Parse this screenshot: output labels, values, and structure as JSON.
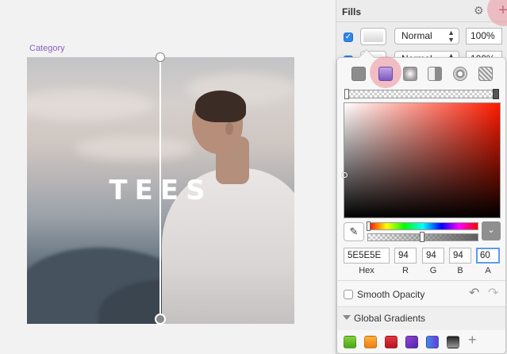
{
  "canvas": {
    "artboard_label": "Category",
    "artboard_text": "TEES"
  },
  "inspector": {
    "fills_title": "Fills",
    "icons": {
      "settings": "gear-icon",
      "add": "plus-icon"
    },
    "fills": [
      {
        "enabled": true,
        "blend_mode": "Normal",
        "opacity": "100%"
      },
      {
        "enabled": true,
        "blend_mode": "Normal",
        "opacity": "100%"
      }
    ]
  },
  "color_picker": {
    "fill_types": [
      "solid",
      "linear-gradient",
      "radial-gradient",
      "angular-gradient",
      "pattern",
      "noise"
    ],
    "selected_fill_type": "linear-gradient",
    "hue_color": "#ff1a00",
    "hex_value": "5E5E5E",
    "r_value": "94",
    "g_value": "94",
    "b_value": "94",
    "a_value": "60",
    "labels": {
      "hex": "Hex",
      "r": "R",
      "g": "G",
      "b": "B",
      "a": "A"
    },
    "smooth_opacity_label": "Smooth Opacity",
    "global_gradients_label": "Global Gradients",
    "gradients": [
      {
        "name": "green",
        "from": "#86d33c",
        "to": "#4aa51c"
      },
      {
        "name": "orange",
        "from": "#ffb13d",
        "to": "#f07c12"
      },
      {
        "name": "red",
        "from": "#e5363d",
        "to": "#b51420"
      },
      {
        "name": "purple",
        "from": "#9a3fd6",
        "to": "#4a2aa8"
      },
      {
        "name": "blue",
        "from": "#3a8ee6",
        "to": "#6a3ad8"
      },
      {
        "name": "dark",
        "from": "#222222",
        "to": "#999999"
      }
    ]
  }
}
